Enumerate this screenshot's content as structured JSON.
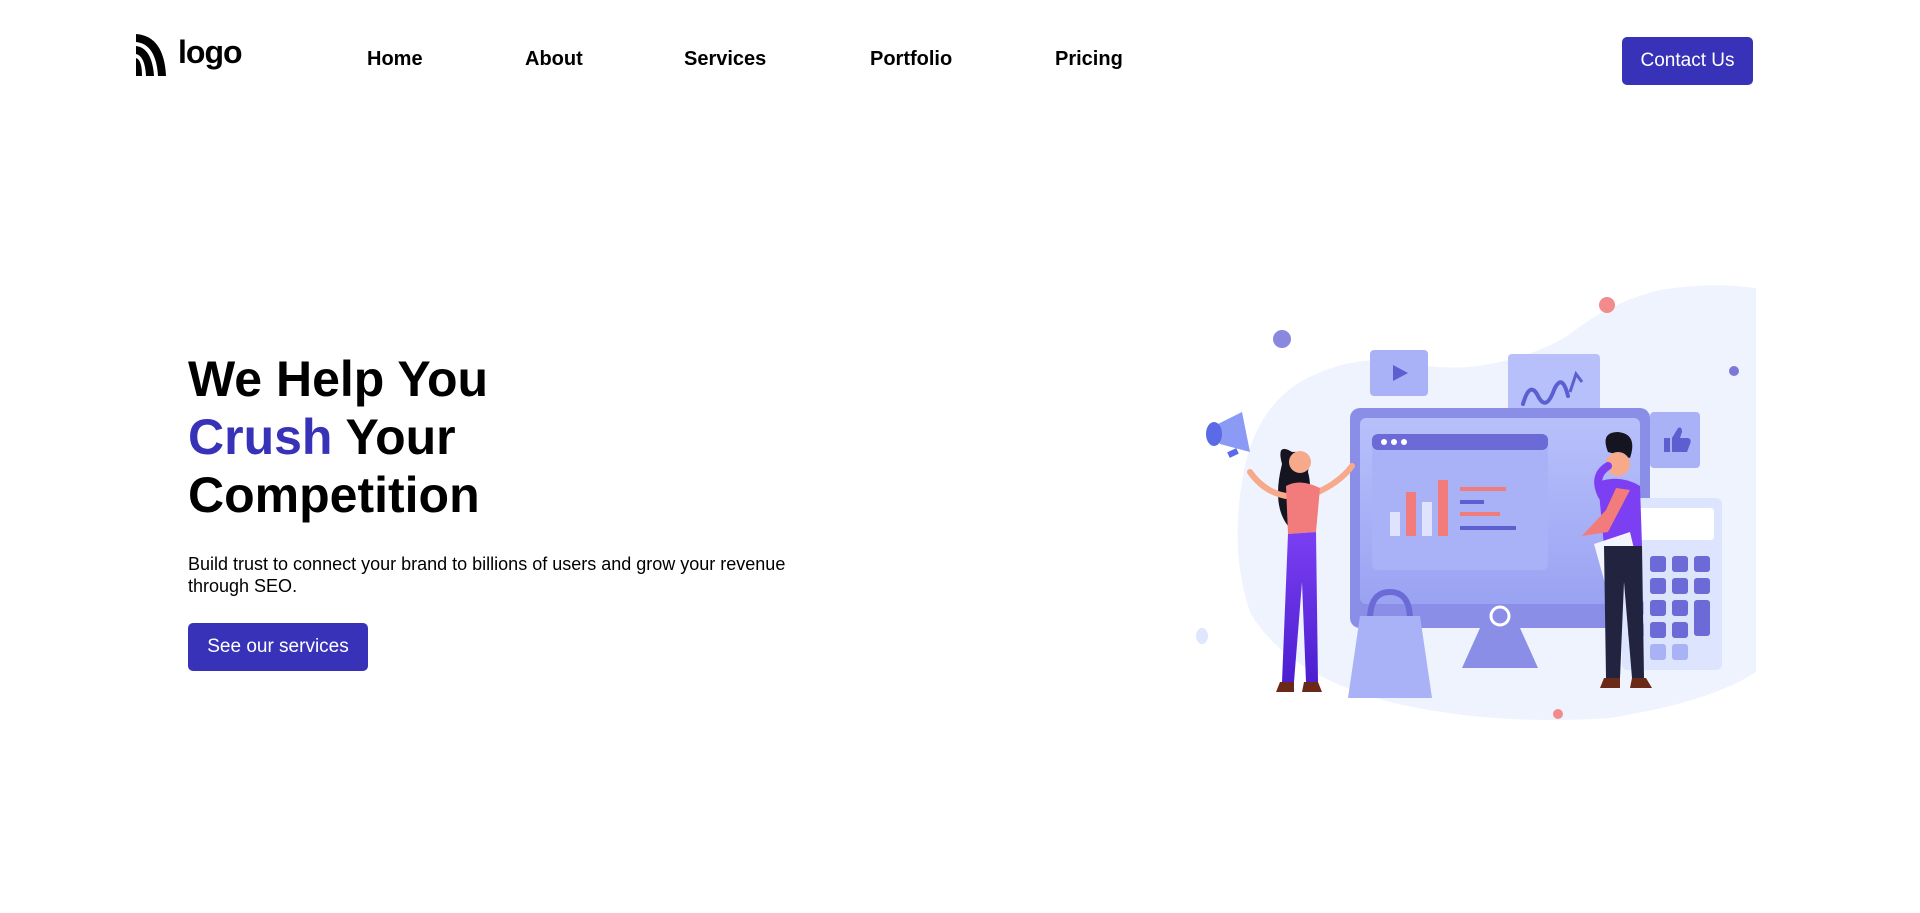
{
  "header": {
    "logo_text": "logo",
    "nav": [
      "Home",
      "About",
      "Services",
      "Portfolio",
      "Pricing"
    ],
    "cta_label": "Contact Us"
  },
  "hero": {
    "title_line1": "We Help You",
    "title_accent": "Crush",
    "title_line2_rest": " Your",
    "title_line3": "Competition",
    "description": "Build trust to connect your brand to billions of users and grow your revenue through SEO.",
    "button_label": "See our services"
  },
  "colors": {
    "brand": "#3832b8",
    "text": "#000000",
    "background": "#ffffff",
    "illustration_blob": "#eef3fe",
    "illustration_accent": "#f27b7b",
    "illustration_periwinkle": "#a9b2f7"
  },
  "icons": {
    "logo": "logo-mark-icon",
    "illustration": "marketing-team-illustration"
  }
}
